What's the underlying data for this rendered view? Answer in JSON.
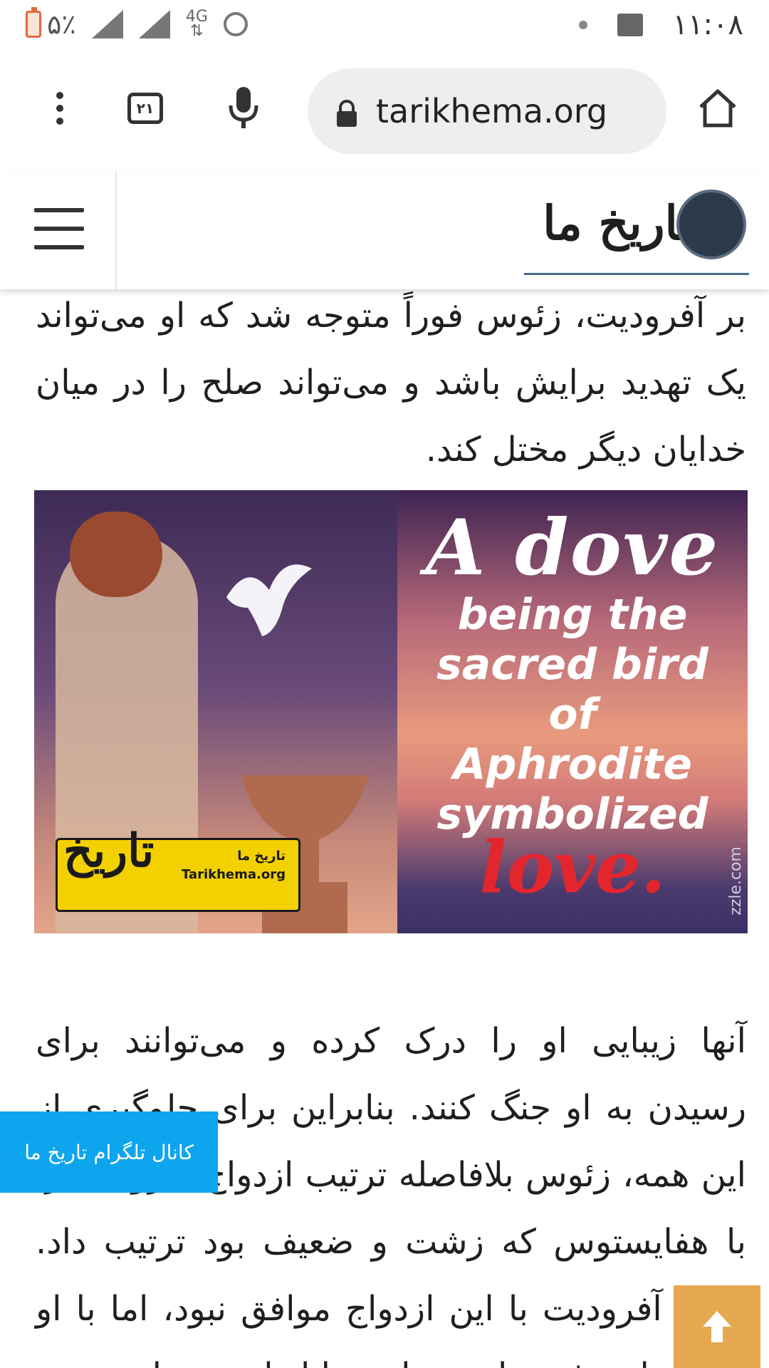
{
  "status_bar": {
    "battery": "۵٪",
    "network": "4G",
    "time": "۱۱:۰۸",
    "icons": [
      "battery-icon",
      "signal-x-icon",
      "signal-icon",
      "data-4g-icon",
      "alarm-icon",
      "dot-icon",
      "image-icon"
    ]
  },
  "browser": {
    "url": "tarikhema.org",
    "tab_count": "۲۱",
    "icons": [
      "more-vert-icon",
      "tabs-icon",
      "mic-icon",
      "lock-icon",
      "home-icon"
    ]
  },
  "site": {
    "logo_text": "تاریخ ما",
    "icons": [
      "hamburger-icon"
    ]
  },
  "article": {
    "paragraph_top": "بر آفرودیت، زئوس فوراً متوجه شد که او می‌تواند یک تهدید برایش باشد و می‌تواند صلح را در میان خدایان دیگر مختل کند.",
    "image": {
      "caption_line1": "A dove",
      "caption_line2": "being the",
      "caption_line3": "sacred bird",
      "caption_line4": "of",
      "caption_line5": "Aphrodite",
      "caption_line6": "symbolized",
      "caption_love": "love.",
      "credit": "zzle.com",
      "watermark_title": "تاریخ ما",
      "watermark_url": "Tarikhema.org",
      "watermark_mark": "تاریخ"
    },
    "paragraph_main": "آنها زیبایی او را درک کرده و می‌توانند برای رسیدن به او جنگ کنند. بنابراین برای جلوگیری از این همه، زئوس بلافاصله ترتیب ازدواج آفرودیت را با هفایستوس که زشت و ضعیف بود ترتیب داد. البته، آفرودیت با این ازدواج موافق نبود، اما با او ادامه داد و فرزندان بسیاری را از او به دنیا"
  },
  "telegram_banner": "کانال تلگرام تاریخ ما",
  "colors": {
    "telegram": "#0ea5ef",
    "scroll_top": "#e5a84f",
    "love_red": "#e3262e"
  }
}
